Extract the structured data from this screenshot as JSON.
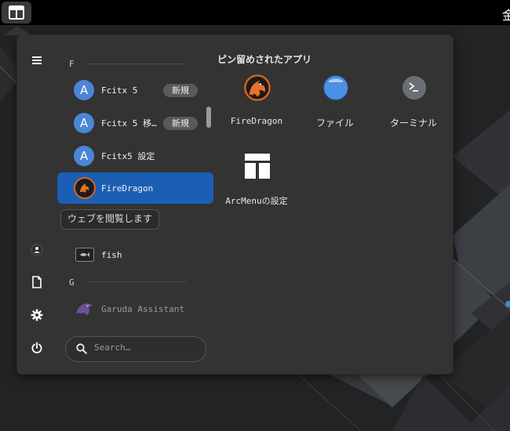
{
  "topbar": {
    "menu_button_icon": "arcmenu-layout-icon",
    "clock_fragment": "金"
  },
  "sidebar": {
    "items": [
      {
        "name": "hamburger-menu-icon"
      },
      {
        "name": "user-icon"
      },
      {
        "name": "document-icon"
      },
      {
        "name": "settings-gear-icon"
      },
      {
        "name": "power-icon"
      }
    ]
  },
  "app_list": {
    "sections": [
      {
        "header": "F"
      },
      {
        "header": "G"
      }
    ],
    "items": [
      {
        "label": "Fcitx 5",
        "badge": "新規",
        "icon": "fcitx-a-icon",
        "icon_letter": "A"
      },
      {
        "label": "Fcitx 5 移…",
        "badge": "新規",
        "icon": "fcitx-a-icon",
        "icon_letter": "A"
      },
      {
        "label": "Fcitx5 設定",
        "icon": "fcitx-a-icon",
        "icon_letter": "A"
      },
      {
        "label": "FireDragon",
        "icon": "firedragon-icon",
        "selected": true
      },
      {
        "label": "fish",
        "icon": "terminal-fish-icon"
      },
      {
        "label": "Garuda Assistant",
        "icon": "garuda-eagle-icon"
      }
    ],
    "tooltip": "ウェブを閲覧します"
  },
  "search": {
    "placeholder": "Search…"
  },
  "pinned": {
    "title": "ピン留めされたアプリ",
    "apps": [
      {
        "label": "FireDragon",
        "icon": "firedragon-icon"
      },
      {
        "label": "ファイル",
        "icon": "folder-icon"
      },
      {
        "label": "ターミナル",
        "icon": "terminal-icon"
      },
      {
        "label": "ArcMenuの設定",
        "icon": "arcmenu-settings-icon"
      }
    ]
  },
  "colors": {
    "menu_bg": "#333333",
    "selected_bg": "#1b5fb5",
    "accent_blue": "#4b86d6",
    "topbar_bg": "#000000"
  }
}
